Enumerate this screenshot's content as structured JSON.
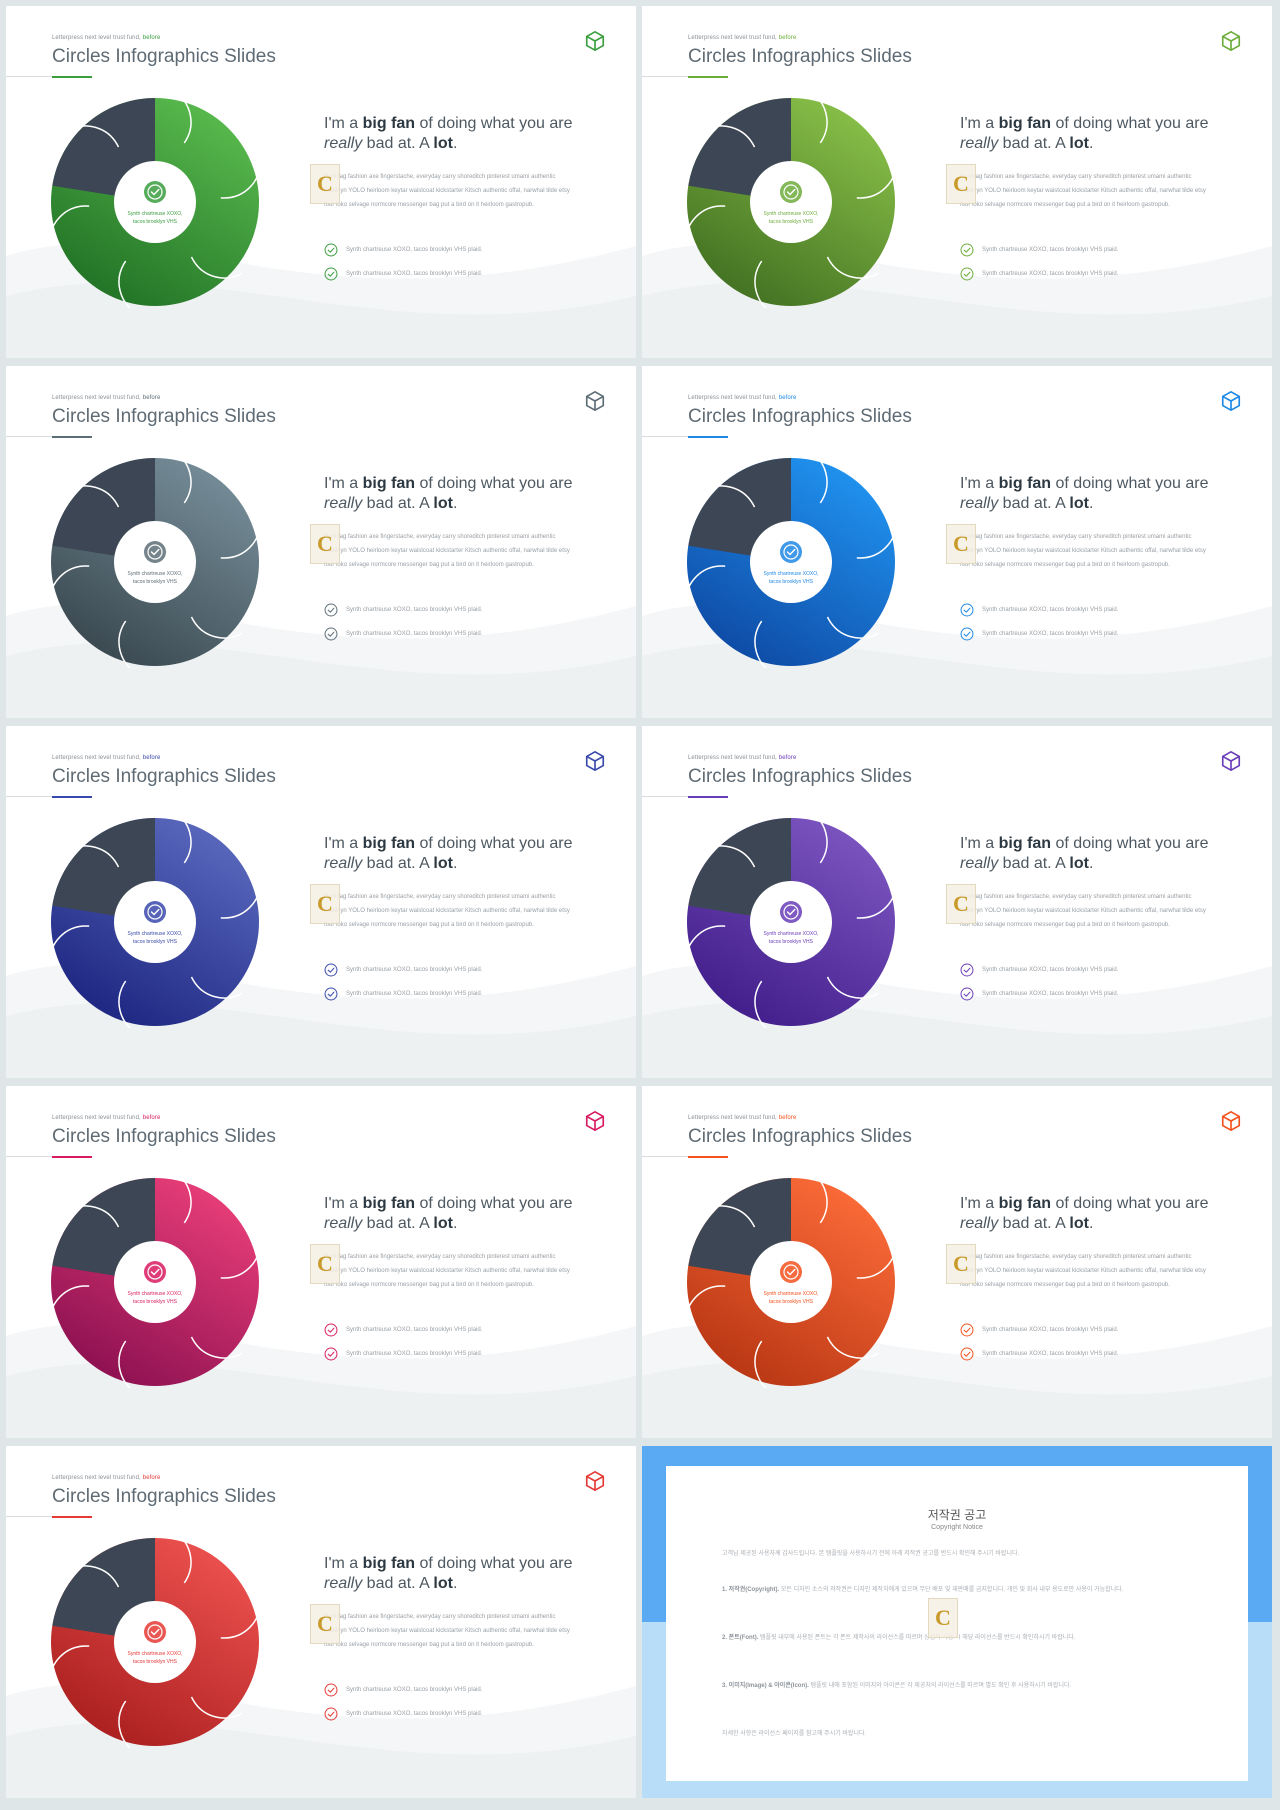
{
  "slide_common": {
    "eyebrow": "Letterpress next level trust fund,",
    "eyebrow_accent": "before",
    "title": "Circles Infographics Slides",
    "headline": {
      "p1": "I'm a ",
      "b1": "big fan",
      "p2": " of doing what you are ",
      "i1": "really",
      "p3": " bad at. A ",
      "b2": "lot",
      "p4": "."
    },
    "body": "Hashtag fashion axe fingerstache, everyday carry shoreditch pinterest umami authentic brooklyn YOLO heirloom keytar waistcoat kickstarter Kitsch authentic offal, narwhal tilde etsy four loko selvage normcore messenger bag put a bird on it heirloom gastropub.",
    "check_items": [
      "Synth chartreuse XOXO, tacos brooklyn VHS plaid.",
      "Synth chartreuse XOXO, tacos brooklyn VHS plaid."
    ],
    "center_label_1": "Synth chartreuse XOXO,",
    "center_label_2": "tacos brooklyn VHS",
    "badge_glyph": "C"
  },
  "slides": [
    {
      "theme": "green",
      "accent": "#3a9e3e",
      "light": "#5bbd4f",
      "dark": "#1f6f24"
    },
    {
      "theme": "lime-green",
      "accent": "#6cac3a",
      "light": "#8bc34a",
      "dark": "#3f6d20"
    },
    {
      "theme": "slate-grey",
      "accent": "#5d6d76",
      "light": "#78909c",
      "dark": "#37454c"
    },
    {
      "theme": "blue",
      "accent": "#1e88e5",
      "light": "#2196f3",
      "dark": "#0d47a1"
    },
    {
      "theme": "indigo",
      "accent": "#3949ab",
      "light": "#5c6bc0",
      "dark": "#1a237e"
    },
    {
      "theme": "purple",
      "accent": "#6a3db8",
      "light": "#7e57c2",
      "dark": "#3e1b88"
    },
    {
      "theme": "pink",
      "accent": "#d81b60",
      "light": "#ec407a",
      "dark": "#880e4f"
    },
    {
      "theme": "orange",
      "accent": "#f4511e",
      "light": "#ff6d3a",
      "dark": "#b53412"
    },
    {
      "theme": "red",
      "accent": "#e53935",
      "light": "#ef5350",
      "dark": "#a71d1d"
    }
  ],
  "notice": {
    "title": "저작권 공고",
    "subtitle": "Copyright Notice",
    "intro": "고객님 제공된 사용자께 감사드립니다. 본 템플릿을 사용하시기 전에 아래 저작권 공고를 반드시 확인해 주시기 바랍니다.",
    "p1_head": "1. 저작권(Copyright).",
    "p1": " 모든 디자인 소스의 저작권은 디자인 제작자에게 있으며 무단 배포 및 재판매를 금지합니다. 개인 및 회사 내부 용도로만 사용이 가능합니다.",
    "p2_head": "2. 폰트(Font).",
    "p2": " 템플릿 내부에 사용된 폰트는 각 폰트 제작사의 라이선스를 따르며 상업적 사용 시 해당 라이선스를 반드시 확인하시기 바랍니다.",
    "p3_head": "3. 이미지(Image) & 아이콘(Icon).",
    "p3": " 템플릿 내에 포함된 이미지와 아이콘은 각 제공처의 라이선스를 따르며 별도 확인 후 사용하시기 바랍니다.",
    "outro": "자세한 사항은 라이선스 페이지를 참고해 주시기 바랍니다."
  },
  "colors": {
    "page_bg": "#dfe6e8",
    "dark_segment": "#3c4654",
    "notice_blue": "#5aa9f3",
    "notice_light": "#b7ddf8"
  },
  "icons": {
    "corner": "box-icon",
    "check": "check-circle-icon",
    "center": "check-circle-icon"
  }
}
